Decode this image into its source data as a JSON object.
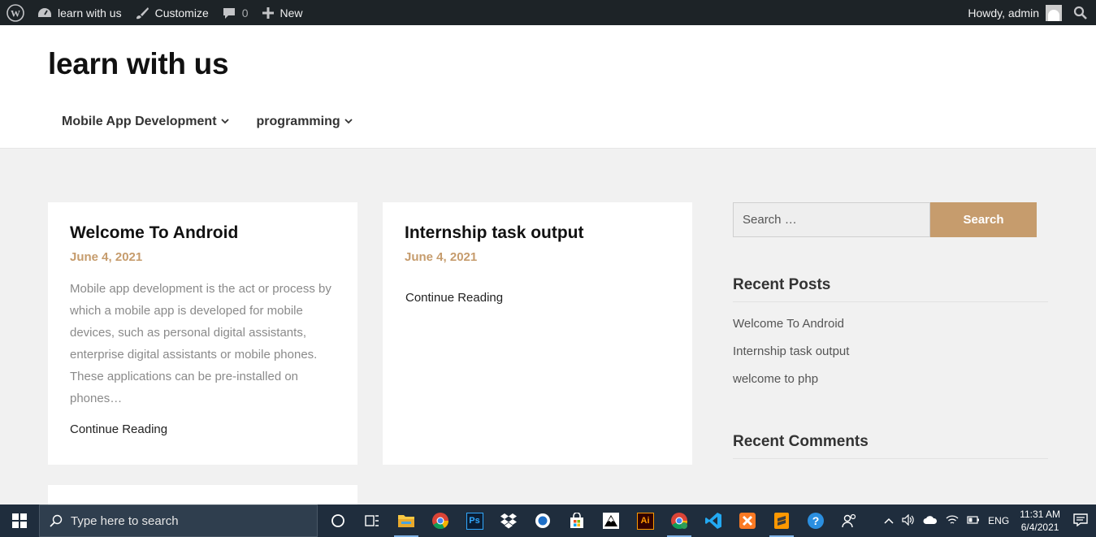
{
  "admin_bar": {
    "site_name": "learn with us",
    "customize": "Customize",
    "comments_count": "0",
    "new_label": "New",
    "howdy": "Howdy, admin"
  },
  "header": {
    "site_title": "learn with us",
    "menu": [
      {
        "label": "Mobile App Development"
      },
      {
        "label": "programming"
      }
    ]
  },
  "posts": [
    {
      "title": "Welcome To Android",
      "date": "June 4, 2021",
      "excerpt": "Mobile app development is the act or process by which a mobile app is developed for mobile devices, such as personal digital assistants, enterprise digital assistants or mobile phones. These applications can be pre-installed on phones…",
      "continue": "Continue Reading"
    },
    {
      "title": "Internship task output",
      "date": "June 4, 2021",
      "continue": "Continue Reading"
    }
  ],
  "sidebar": {
    "search_placeholder": "Search …",
    "search_button": "Search",
    "recent_posts_title": "Recent Posts",
    "recent_posts": [
      "Welcome To Android",
      "Internship task output",
      "welcome to php"
    ],
    "recent_comments_title": "Recent Comments"
  },
  "taskbar": {
    "search_placeholder": "Type here to search",
    "language": "ENG",
    "time": "11:31 AM",
    "date": "6/4/2021",
    "apps": [
      "cortana-icon",
      "task-view-icon",
      "file-explorer-icon",
      "chrome-icon",
      "photoshop-icon",
      "dropbox-icon",
      "app-icon",
      "store-icon",
      "inkscape-icon",
      "illustrator-icon",
      "chrome-profile-icon",
      "vscode-icon",
      "xampp-icon",
      "sublime-icon",
      "help-icon",
      "people-icon"
    ],
    "app_labels": {
      "photoshop": "Ps",
      "illustrator": "Ai"
    }
  },
  "colors": {
    "accent": "#c69c6d",
    "admin_bar": "#1d2327",
    "taskbar": "#1f2d3d",
    "page_bg": "#f1f1f1"
  }
}
